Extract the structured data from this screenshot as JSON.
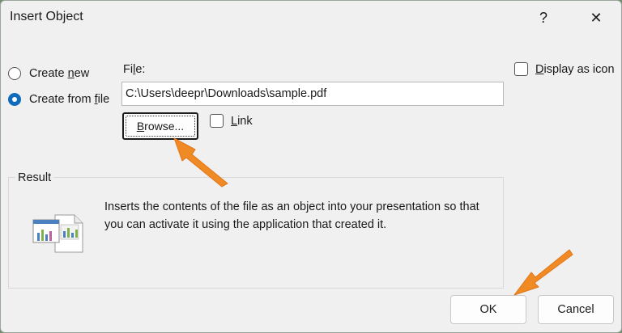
{
  "dialog": {
    "title": "Insert Object",
    "help_glyph": "?",
    "close_glyph": "✕"
  },
  "options": {
    "create_new": {
      "accel": "Create ",
      "underlined": "n",
      "rest": "ew",
      "selected": false
    },
    "create_from_file": {
      "pre": "Create from ",
      "underlined": "f",
      "rest": "ile",
      "selected": true
    }
  },
  "file": {
    "label_pre": "Fi",
    "label_underlined": "l",
    "label_rest": "e:",
    "value": "C:\\Users\\deepr\\Downloads\\sample.pdf"
  },
  "browse": {
    "underlined": "B",
    "rest": "rowse..."
  },
  "link": {
    "underlined": "L",
    "rest": "ink",
    "checked": false
  },
  "display_as_icon": {
    "underlined": "D",
    "rest": "isplay as icon",
    "checked": false
  },
  "result": {
    "label": "Result",
    "text": "Inserts the contents of the file as an object into your presentation so that you can activate it using the application that created it."
  },
  "buttons": {
    "ok": "OK",
    "cancel": "Cancel"
  },
  "icons": {
    "help": "help-icon",
    "close": "close-icon",
    "result": "object-document-icon",
    "annotation": "orange-arrow-annotation"
  },
  "colors": {
    "accent": "#0f6cbd",
    "annotation": "#f08a24",
    "dialog_bg": "#f0f0f0"
  }
}
